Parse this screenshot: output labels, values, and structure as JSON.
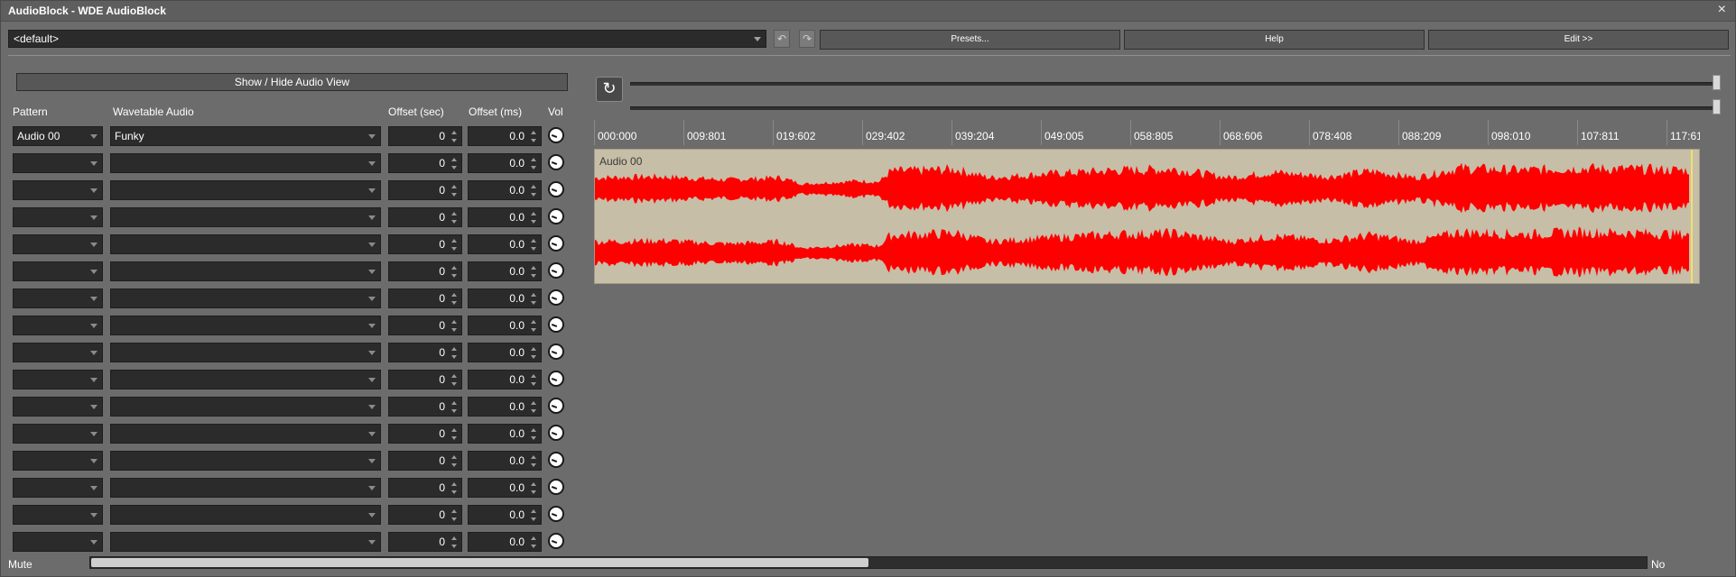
{
  "window": {
    "title": "AudioBlock - WDE AudioBlock",
    "close_glyph": "×"
  },
  "toolbar": {
    "preset_value": "<default>",
    "presets_label": "Presets...",
    "help_label": "Help",
    "edit_label": "Edit >>",
    "undo_glyph": "↶",
    "redo_glyph": "↷"
  },
  "left_panel": {
    "show_hide_label": "Show / Hide Audio View",
    "headers": {
      "pattern": "Pattern",
      "wavetable": "Wavetable Audio",
      "offset_sec": "Offset (sec)",
      "offset_ms": "Offset (ms)",
      "vol": "Vol"
    },
    "rows": [
      {
        "pattern": "Audio 00",
        "wavetable": "Funky",
        "offset_sec": "0",
        "offset_ms": "0.0"
      },
      {
        "pattern": "",
        "wavetable": "",
        "offset_sec": "0",
        "offset_ms": "0.0"
      },
      {
        "pattern": "",
        "wavetable": "",
        "offset_sec": "0",
        "offset_ms": "0.0"
      },
      {
        "pattern": "",
        "wavetable": "",
        "offset_sec": "0",
        "offset_ms": "0.0"
      },
      {
        "pattern": "",
        "wavetable": "",
        "offset_sec": "0",
        "offset_ms": "0.0"
      },
      {
        "pattern": "",
        "wavetable": "",
        "offset_sec": "0",
        "offset_ms": "0.0"
      },
      {
        "pattern": "",
        "wavetable": "",
        "offset_sec": "0",
        "offset_ms": "0.0"
      },
      {
        "pattern": "",
        "wavetable": "",
        "offset_sec": "0",
        "offset_ms": "0.0"
      },
      {
        "pattern": "",
        "wavetable": "",
        "offset_sec": "0",
        "offset_ms": "0.0"
      },
      {
        "pattern": "",
        "wavetable": "",
        "offset_sec": "0",
        "offset_ms": "0.0"
      },
      {
        "pattern": "",
        "wavetable": "",
        "offset_sec": "0",
        "offset_ms": "0.0"
      },
      {
        "pattern": "",
        "wavetable": "",
        "offset_sec": "0",
        "offset_ms": "0.0"
      },
      {
        "pattern": "",
        "wavetable": "",
        "offset_sec": "0",
        "offset_ms": "0.0"
      },
      {
        "pattern": "",
        "wavetable": "",
        "offset_sec": "0",
        "offset_ms": "0.0"
      },
      {
        "pattern": "",
        "wavetable": "",
        "offset_sec": "0",
        "offset_ms": "0.0"
      },
      {
        "pattern": "",
        "wavetable": "",
        "offset_sec": "0",
        "offset_ms": "0.0"
      }
    ]
  },
  "audio_view": {
    "refresh_glyph": "↻",
    "timeline_labels": [
      "000:000",
      "009:801",
      "019:602",
      "029:402",
      "039:204",
      "049:005",
      "058:805",
      "068:606",
      "078:408",
      "088:209",
      "098:010",
      "107:811",
      "117:61"
    ],
    "track_label": "Audio 00",
    "waveform_color": "#ff0000",
    "waveform_bg": "#c7bea7"
  },
  "footer": {
    "mute_label": "Mute",
    "no_label": "No",
    "mix_fraction": 0.5
  }
}
